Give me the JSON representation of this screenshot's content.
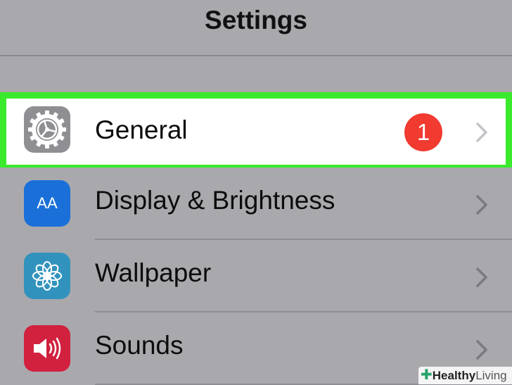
{
  "header": {
    "title": "Settings"
  },
  "rows": [
    {
      "label": "General",
      "badge": "1",
      "icon": "gear-icon"
    },
    {
      "label": "Display & Brightness",
      "icon": "text-size-icon",
      "icon_text": "AA"
    },
    {
      "label": "Wallpaper",
      "icon": "flower-icon"
    },
    {
      "label": "Sounds",
      "icon": "speaker-icon"
    }
  ],
  "watermark": {
    "brand_bold": "Healthy",
    "brand_regular": "Living"
  },
  "colors": {
    "highlight": "#3bea2c",
    "badge": "#f13a30",
    "general_icon": "#8e8e93",
    "display_icon": "#1a70d8",
    "wallpaper_icon": "#3193bd",
    "sounds_icon": "#d2203f"
  }
}
